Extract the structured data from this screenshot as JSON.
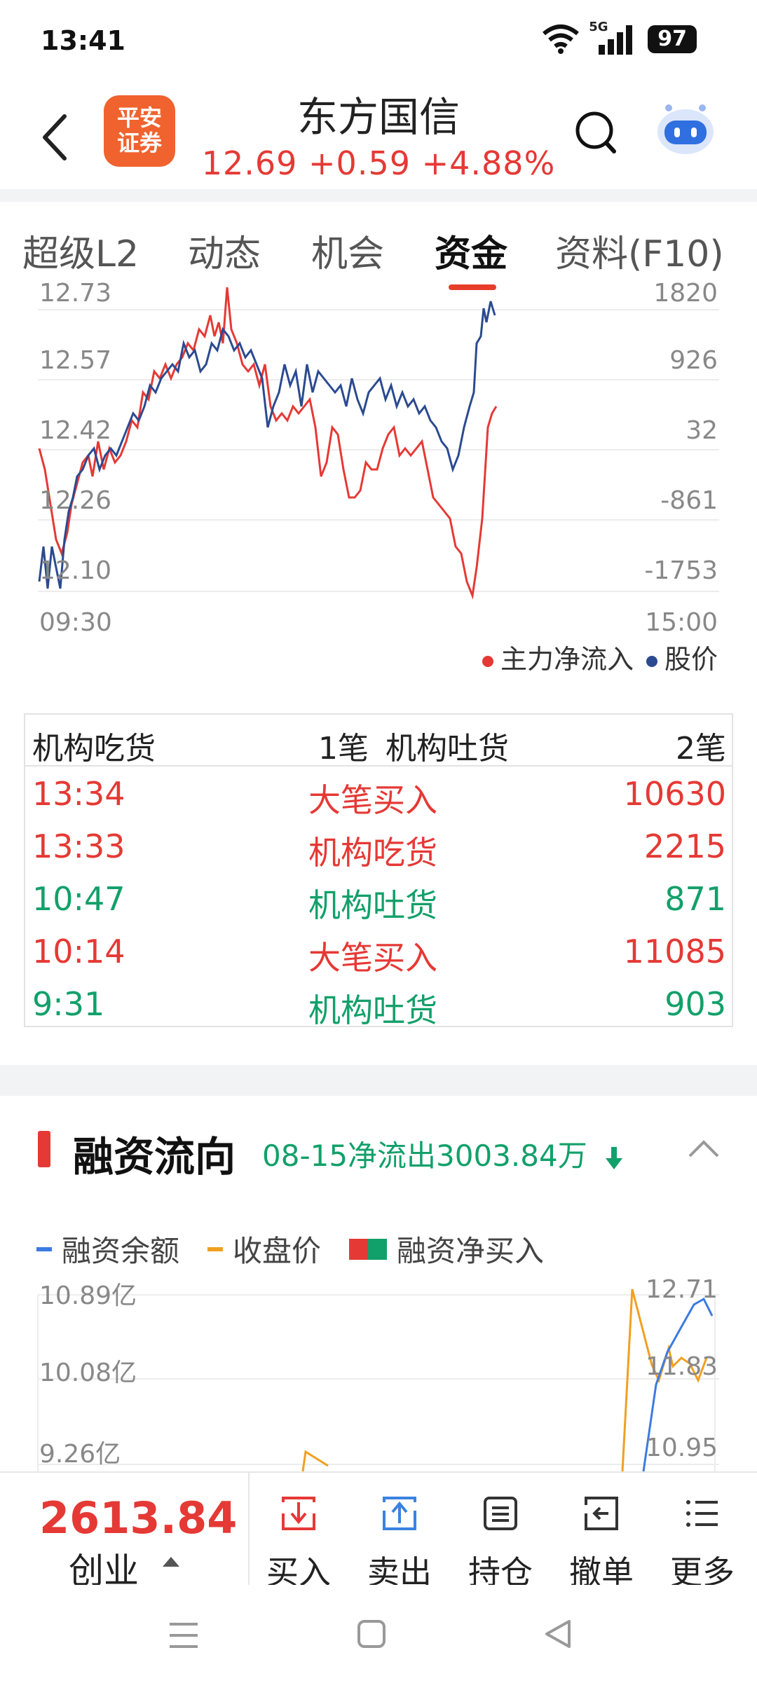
{
  "status_bar": {
    "time": "13:41",
    "network": "5G",
    "battery": "97"
  },
  "header": {
    "logo_text_1": "平安",
    "logo_text_2": "证券",
    "stock_name": "东方国信",
    "quote": "12.69 +0.59 +4.88%"
  },
  "tabs": [
    {
      "label": "超级L2"
    },
    {
      "label": "动态"
    },
    {
      "label": "机会"
    },
    {
      "label": "资金"
    },
    {
      "label": "资料(F10)"
    }
  ],
  "active_tab": "资金",
  "fund_flow_chart": {
    "left_ticks": [
      "12.73",
      "12.57",
      "12.42",
      "12.26",
      "12.10"
    ],
    "right_ticks": [
      "1820",
      "926",
      "32",
      "-861",
      "-1753"
    ],
    "x_start": "09:30",
    "x_end": "15:00",
    "legend": [
      "主力净流入",
      "股价"
    ]
  },
  "institution": {
    "header": {
      "buy_label": "机构吃货",
      "buy_count": "1笔",
      "sell_label": "机构吐货",
      "sell_count": "2笔"
    },
    "rows": [
      {
        "time": "13:34",
        "type": "大笔买入",
        "volume": "10630",
        "color": "red"
      },
      {
        "time": "13:33",
        "type": "机构吃货",
        "volume": "2215",
        "color": "red"
      },
      {
        "time": "10:47",
        "type": "机构吐货",
        "volume": "871",
        "color": "green"
      },
      {
        "time": "10:14",
        "type": "大笔买入",
        "volume": "11085",
        "color": "red"
      },
      {
        "time": "9:31",
        "type": "机构吐货",
        "volume": "903",
        "color": "green"
      }
    ]
  },
  "margin_flow": {
    "title": "融资流向",
    "subtitle": "08-15净流出3003.84万",
    "legend": [
      "融资余额",
      "收盘价",
      "融资净买入"
    ],
    "left_ticks": [
      "10.89亿",
      "10.08亿",
      "9.26亿"
    ],
    "right_ticks": [
      "12.71",
      "11.83",
      "10.95"
    ]
  },
  "bottom_bar": {
    "index_value": "2613.84",
    "index_name": "创业",
    "actions": [
      "买入",
      "卖出",
      "持仓",
      "撤单",
      "更多"
    ]
  },
  "colors": {
    "red": "#e53935",
    "green": "#12a06a",
    "blue": "#2b4a8f",
    "orange": "#f0a020",
    "accent": "#e63e2b"
  },
  "chart_data": [
    {
      "type": "line",
      "x": [
        "09:30",
        "15:00"
      ],
      "series": [
        {
          "name": "主力净流入",
          "values": [
            -200,
            -1200,
            -1700,
            -300,
            400,
            900,
            1500,
            1800,
            900,
            300,
            200,
            -600,
            -300,
            -800,
            -300,
            -400,
            -1700,
            100
          ]
        },
        {
          "name": "股价",
          "values": [
            12.12,
            12.16,
            12.33,
            12.37,
            12.52,
            12.6,
            12.56,
            12.48,
            12.52,
            12.5,
            12.46,
            12.47,
            12.41,
            12.38,
            12.72
          ]
        }
      ],
      "ylim_left": [
        12.1,
        12.73
      ],
      "ylim_right": [
        -1753,
        1820
      ]
    },
    {
      "type": "line",
      "series": [
        {
          "name": "融资余额",
          "values": [
            9.2,
            10.2,
            10.9,
            10.6
          ]
        },
        {
          "name": "收盘价",
          "values": [
            10.95,
            10.9,
            12.71,
            11.8,
            12.2,
            11.9
          ]
        }
      ]
    }
  ]
}
